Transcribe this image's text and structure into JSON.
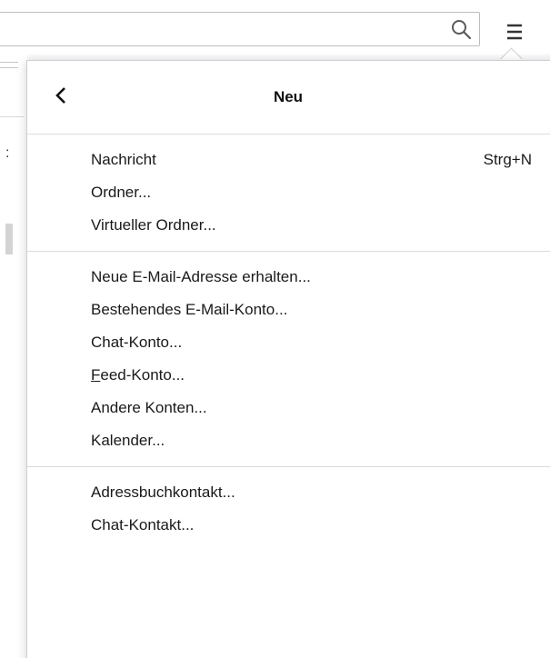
{
  "menu": {
    "title": "Neu",
    "sections": [
      {
        "items": [
          {
            "label": "Nachricht",
            "shortcut": "Strg+N"
          },
          {
            "label": "Ordner..."
          },
          {
            "label": "Virtueller Ordner..."
          }
        ]
      },
      {
        "items": [
          {
            "label": "Neue E-Mail-Adresse erhalten..."
          },
          {
            "label": "Bestehendes E-Mail-Konto..."
          },
          {
            "label": "Chat-Konto..."
          },
          {
            "label": "Feed-Konto...",
            "access_key": "F"
          },
          {
            "label": "Andere Konten..."
          },
          {
            "label": "Kalender..."
          }
        ]
      },
      {
        "items": [
          {
            "label": "Adressbuchkontakt..."
          },
          {
            "label": "Chat-Kontakt..."
          }
        ]
      }
    ]
  },
  "icons": {
    "search": "search-icon",
    "menu": "hamburger-menu-icon",
    "back": "chevron-left-icon"
  },
  "colors": {
    "panel_border": "#cfcfd2",
    "separator": "#dcdcdc",
    "text": "#1a1a1a"
  }
}
